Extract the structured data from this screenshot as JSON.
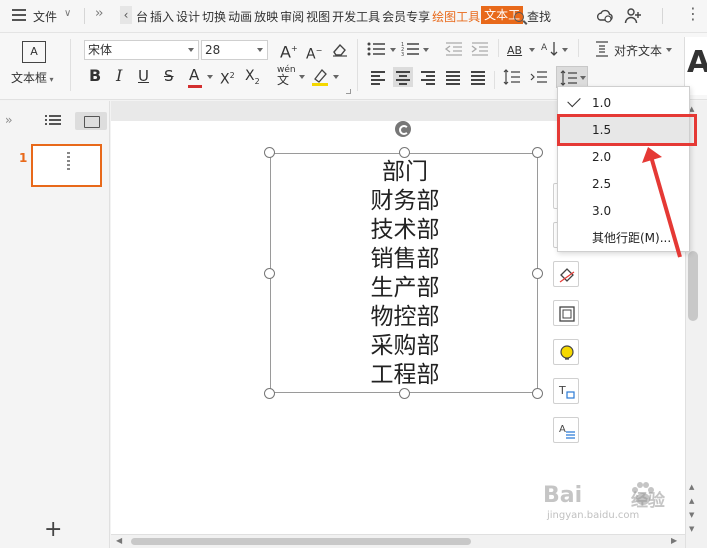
{
  "menubar": {
    "file_label": "文件",
    "tabs": [
      {
        "label": "台",
        "style": "normal"
      },
      {
        "label": "插入",
        "style": "normal"
      },
      {
        "label": "设计",
        "style": "normal"
      },
      {
        "label": "切换",
        "style": "normal"
      },
      {
        "label": "动画",
        "style": "normal"
      },
      {
        "label": "放映",
        "style": "normal"
      },
      {
        "label": "审阅",
        "style": "normal"
      },
      {
        "label": "视图",
        "style": "normal"
      },
      {
        "label": " 开发工具",
        "style": "normal"
      },
      {
        "label": " 会员专享",
        "style": "normal"
      },
      {
        "label": " 绘图工具",
        "style": "orange"
      },
      {
        "label": "文本工",
        "style": "active"
      }
    ],
    "search_label": "查找"
  },
  "ribbon": {
    "textbox_label": "文本框",
    "font_name": "宋体",
    "font_size": "28",
    "align_text_label": "对齐文本",
    "pinyin_label": "wén",
    "increase_font_glyph": "A",
    "decrease_font_glyph": "A"
  },
  "left_panel": {
    "slide_number": "1"
  },
  "slide": {
    "lines": [
      "部门",
      "财务部",
      "技术部",
      "销售部",
      "生产部",
      "物控部",
      "采购部",
      "工程部"
    ]
  },
  "line_spacing_menu": {
    "items": [
      {
        "label": "1.0",
        "checked": true,
        "hover": false
      },
      {
        "label": "1.5",
        "checked": false,
        "hover": true
      },
      {
        "label": "2.0",
        "checked": false,
        "hover": false
      },
      {
        "label": "2.5",
        "checked": false,
        "hover": false
      },
      {
        "label": "3.0",
        "checked": false,
        "hover": false
      },
      {
        "label": "其他行距(M)...",
        "checked": false,
        "hover": false
      }
    ]
  },
  "colors": {
    "accent_orange": "#e8691a",
    "highlight_red": "#e53935",
    "font_color_underline": "#d32f2f",
    "highlight_yellow": "#f5d800"
  },
  "watermark": {
    "brand": "Bai",
    "brand_cn": "经验",
    "url": "jingyan.baidu.com"
  }
}
